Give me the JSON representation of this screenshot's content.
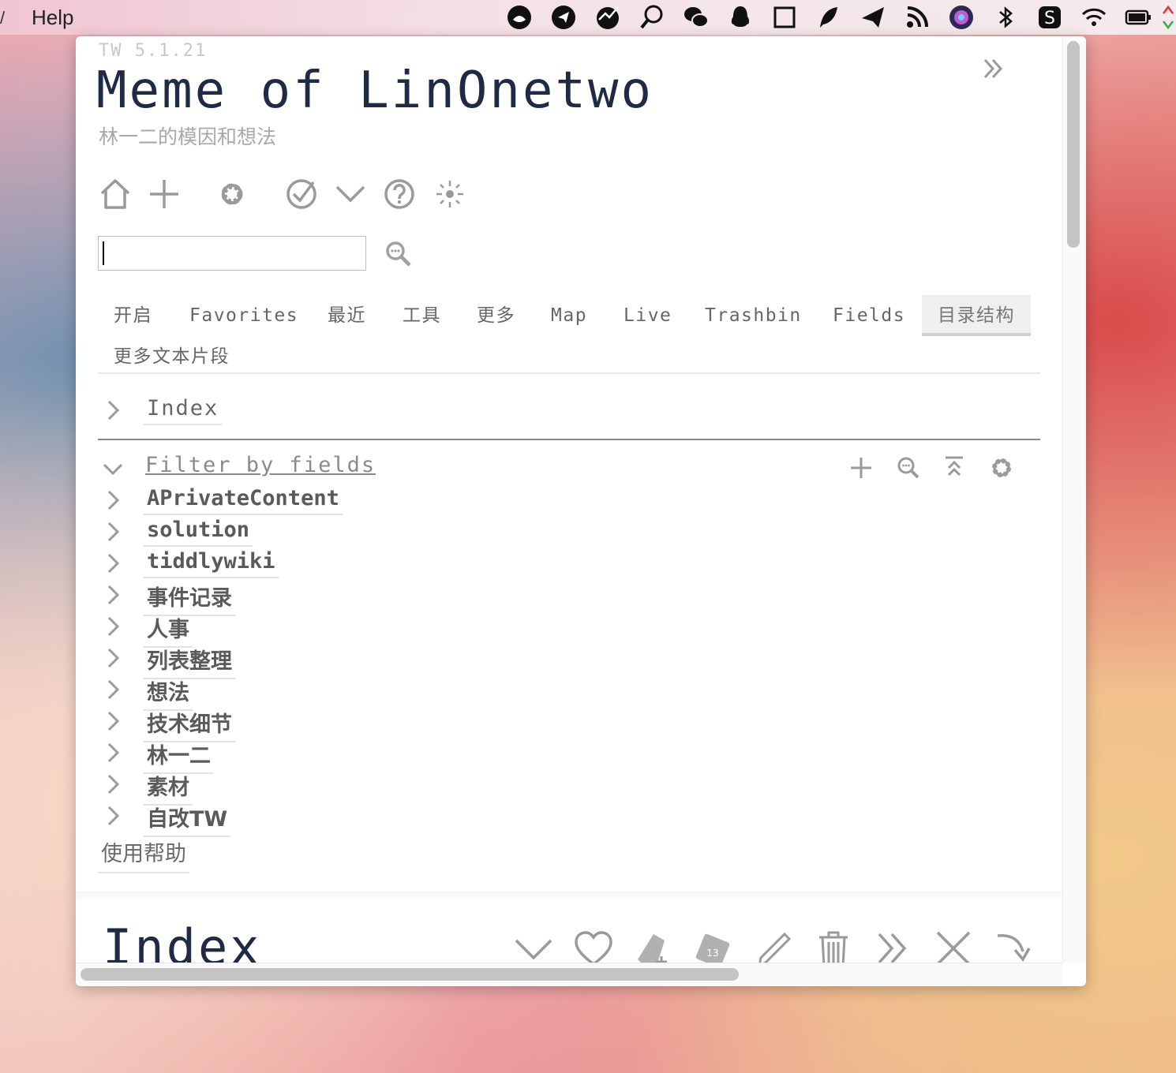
{
  "menubar": {
    "help_label": "Help",
    "edge_mark": "/",
    "tray_icons": [
      "cat-app-icon",
      "telegram-icon",
      "stocks-icon",
      "app-search-icon",
      "wechat-icon",
      "qq-penguin-icon",
      "window-frame-icon",
      "feather-icon",
      "mailplane-icon",
      "rss-icon",
      "siri-icon",
      "bluetooth-icon",
      "sogou-input-icon",
      "wifi-icon",
      "battery-icon",
      "network-traffic-icon"
    ]
  },
  "wiki": {
    "version": "TW 5.1.21",
    "title": "Meme of LinOnetwo",
    "subtitle": "林一二的模因和想法"
  },
  "search": {
    "value": "",
    "placeholder": ""
  },
  "tabs": [
    {
      "label": "开启"
    },
    {
      "label": "Favorites"
    },
    {
      "label": "最近"
    },
    {
      "label": "工具"
    },
    {
      "label": "更多"
    },
    {
      "label": "Map"
    },
    {
      "label": "Live"
    },
    {
      "label": "Trashbin"
    },
    {
      "label": "Fields"
    },
    {
      "label": "目录结构",
      "active": true
    },
    {
      "label": "更多文本片段"
    }
  ],
  "toc": {
    "index_label": "Index",
    "filter_label": "Filter by fields",
    "items": [
      {
        "label": "APrivateContent"
      },
      {
        "label": "solution"
      },
      {
        "label": "tiddlywiki"
      },
      {
        "label": "事件记录"
      },
      {
        "label": "人事"
      },
      {
        "label": "列表整理"
      },
      {
        "label": "想法"
      },
      {
        "label": "技术细节"
      },
      {
        "label": "林一二"
      },
      {
        "label": "素材"
      },
      {
        "label": "自改TW"
      }
    ],
    "help_label": "使用帮助"
  },
  "story": {
    "title": "Index"
  },
  "colors": {
    "title": "#1f2a44",
    "muted": "#a8a8a8",
    "icon": "#888888"
  }
}
